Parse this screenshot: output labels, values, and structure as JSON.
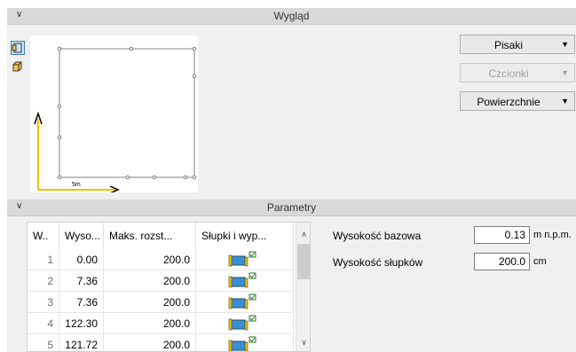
{
  "wyglad": {
    "title": "Wygląd",
    "preview_scale_label": "5m",
    "buttons": {
      "pisaki": "Pisaki",
      "czcionki": "Czcionki",
      "powierzchnie": "Powierzchnie"
    }
  },
  "parametry": {
    "title": "Parametry",
    "columns": [
      "W..",
      "Wyso...",
      "Maks. rozst...",
      "Słupki i wyp..."
    ],
    "rows": [
      {
        "idx": "1",
        "height": "0.00",
        "max": "200.0"
      },
      {
        "idx": "2",
        "height": "7.36",
        "max": "200.0"
      },
      {
        "idx": "3",
        "height": "7.36",
        "max": "200.0"
      },
      {
        "idx": "4",
        "height": "122.30",
        "max": "200.0"
      },
      {
        "idx": "5",
        "height": "121.72",
        "max": "200.0"
      }
    ],
    "fields": [
      {
        "label": "Wysokość bazowa",
        "value": "0.13",
        "unit": "m n.p.m."
      },
      {
        "label": "Wysokość słupków",
        "value": "200.0",
        "unit": "cm"
      }
    ]
  },
  "colors": {
    "axis_arrow": "#f0c000",
    "accent": "#3c7fb1",
    "panel_bg": "#f0f0f0",
    "header_bg": "#d9d9d9"
  },
  "icons": [
    "chevron-down-icon",
    "2d-view-icon",
    "3d-view-icon",
    "post-icon",
    "checkbox-icon"
  ]
}
